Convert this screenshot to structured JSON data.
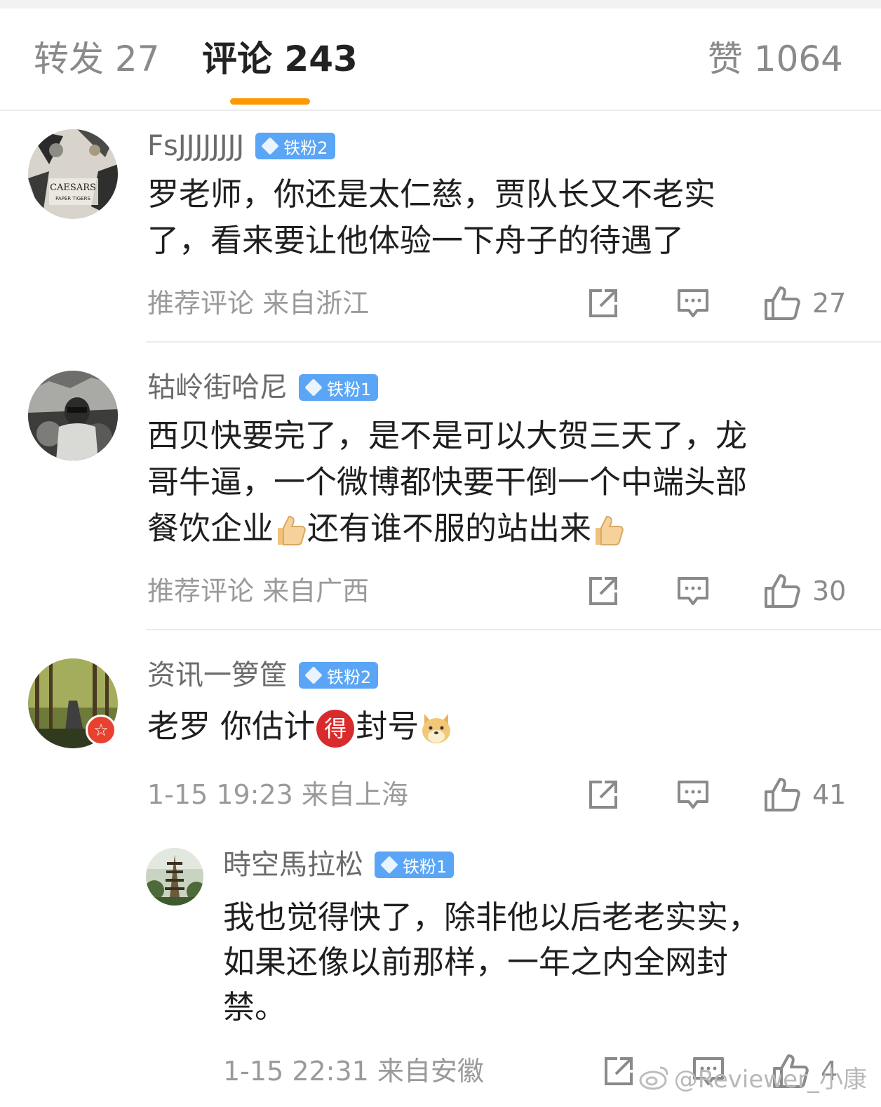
{
  "tabs": {
    "repost": "转发 27",
    "comments": "评论 243",
    "likes": "赞 1064"
  },
  "colors": {
    "accent": "#ff9800",
    "badge": "#5aa5f5",
    "meta": "#9a9a9a"
  },
  "comments": [
    {
      "username": "FsJJJJJJJJ",
      "badge": "铁粉2",
      "lines": [
        "罗老师，你还是太仁慈，贾队长又不老实",
        "了，看来要让他体验一下舟子的待遇了"
      ],
      "meta": "推荐评论  来自浙江",
      "likes": "27"
    },
    {
      "username": "轱岭街哈尼",
      "badge": "铁粉1",
      "lines": [
        "西贝快要完了，是不是可以大贺三天了，龙",
        "哥牛逼，一个微博都快要干倒一个中端头部"
      ],
      "line3a": "餐饮企业",
      "line3b": "还有谁不服的站出来",
      "meta": "推荐评论  来自广西",
      "likes": "30"
    },
    {
      "username": "资讯一箩筐",
      "badge": "铁粉2",
      "text_a": "老罗 你估计",
      "text_b": "封号",
      "emoji_de": "得",
      "meta": "1-15 19:23  来自上海",
      "likes": "41"
    },
    {
      "username": "時空馬拉松",
      "badge": "铁粉1",
      "lines": [
        "我也觉得快了，除非他以后老老实实，",
        "如果还像以前那样，一年之内全网封",
        "禁。"
      ],
      "meta": "1-15 22:31  来自安徽",
      "likes": "4"
    }
  ],
  "avatar_text": {
    "line1": "CAESARS",
    "line2": "PAPER TIGERS"
  },
  "watermark": "@Reviewer_小康"
}
